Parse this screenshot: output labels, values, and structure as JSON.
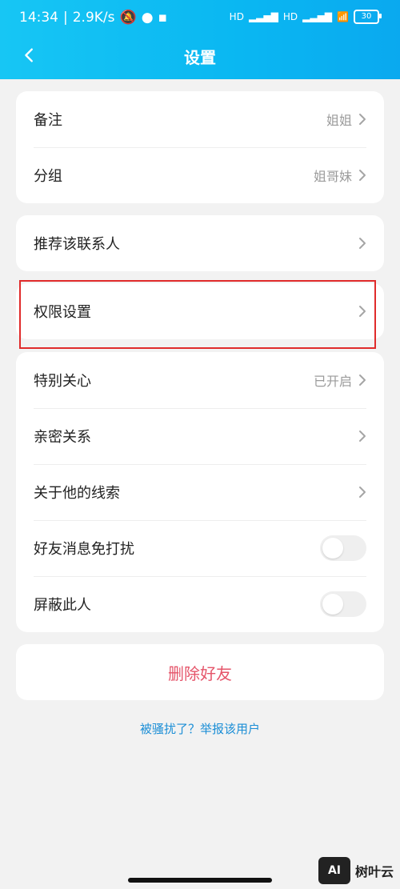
{
  "status": {
    "time": "14:34",
    "net_speed": "2.9K/s",
    "battery": "30",
    "hd1": "HD",
    "hd2": "HD"
  },
  "nav": {
    "title": "设置"
  },
  "group1": [
    {
      "label": "备注",
      "value": "姐姐"
    },
    {
      "label": "分组",
      "value": "姐哥妹"
    }
  ],
  "group2": [
    {
      "label": "推荐该联系人",
      "value": ""
    }
  ],
  "group3": [
    {
      "label": "权限设置",
      "value": ""
    }
  ],
  "group4": [
    {
      "label": "特别关心",
      "value": "已开启"
    },
    {
      "label": "亲密关系",
      "value": ""
    },
    {
      "label": "关于他的线索",
      "value": ""
    },
    {
      "label": "好友消息免打扰",
      "toggle": false
    },
    {
      "label": "屏蔽此人",
      "toggle": false
    }
  ],
  "actions": {
    "delete_friend": "删除好友",
    "report_link": "被骚扰了？举报该用户"
  },
  "watermark": {
    "badge": "AI",
    "text": "树叶云"
  },
  "colors": {
    "header": "#0ab7f2",
    "delete": "#e5556a",
    "link": "#1b8ed6",
    "highlight": "#e02b2b"
  }
}
